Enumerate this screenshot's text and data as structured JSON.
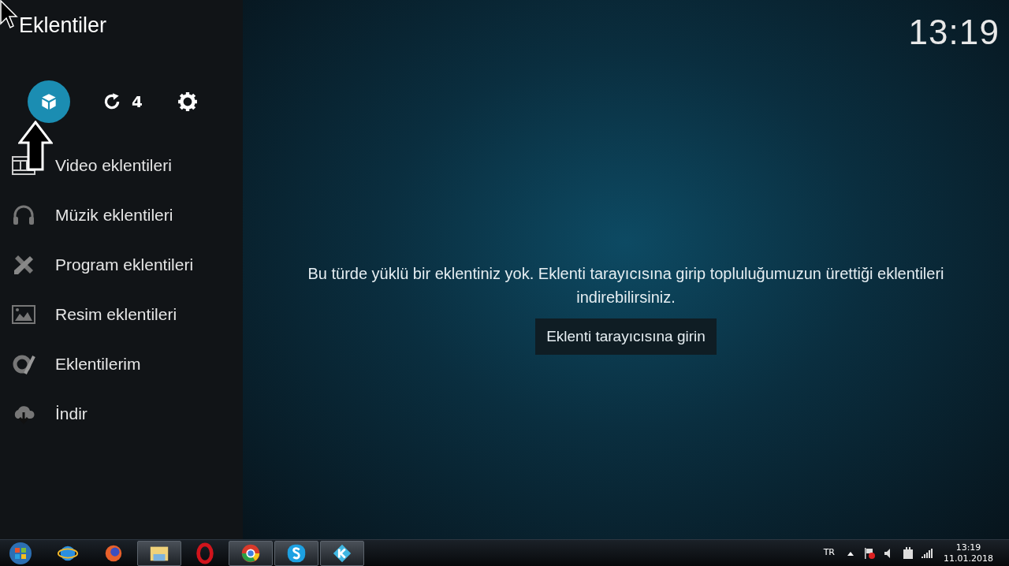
{
  "header": {
    "title": "Eklentiler",
    "clock": "13:19"
  },
  "toolbar": [
    {
      "selected": true
    },
    {
      "selected": false,
      "count": "4"
    },
    {
      "selected": false
    }
  ],
  "menu": [
    {
      "label": "Video eklentileri"
    },
    {
      "label": "Müzik eklentileri"
    },
    {
      "label": "Program eklentileri"
    },
    {
      "label": "Resim eklentileri"
    },
    {
      "label": "Eklentilerim"
    },
    {
      "label": "İndir"
    }
  ],
  "main": {
    "message": "Bu türde yüklü bir eklentiniz yok. Eklenti tarayıcısına girip topluluğumuzun ürettiği eklentileri indirebilirsiniz.",
    "button": "Eklenti tarayıcısına girin"
  },
  "taskbar": {
    "apps": [
      {
        "running": false
      },
      {
        "running": false
      },
      {
        "running": true
      },
      {
        "running": false
      },
      {
        "running": true
      },
      {
        "running": true
      },
      {
        "running": true
      }
    ],
    "language": "TR",
    "time": "13:19",
    "date": "11.01.2018"
  }
}
